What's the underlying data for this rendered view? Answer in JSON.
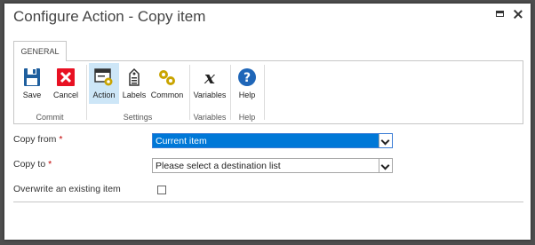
{
  "dialog": {
    "title": "Configure Action - Copy item"
  },
  "ribbon": {
    "tab_label": "GENERAL",
    "groups": [
      {
        "label": "Commit",
        "buttons": [
          {
            "label": "Save",
            "icon": "save-icon"
          },
          {
            "label": "Cancel",
            "icon": "cancel-icon"
          }
        ]
      },
      {
        "label": "Settings",
        "buttons": [
          {
            "label": "Action",
            "icon": "action-icon"
          },
          {
            "label": "Labels",
            "icon": "labels-icon"
          },
          {
            "label": "Common",
            "icon": "common-icon"
          }
        ]
      },
      {
        "label": "Variables",
        "buttons": [
          {
            "label": "Variables",
            "icon": "variables-icon"
          }
        ]
      },
      {
        "label": "Help",
        "buttons": [
          {
            "label": "Help",
            "icon": "help-icon"
          }
        ]
      }
    ]
  },
  "form": {
    "copy_from": {
      "label": "Copy from",
      "required_mark": "*",
      "value": "Current item"
    },
    "copy_to": {
      "label": "Copy to",
      "required_mark": "*",
      "value": "Please select a destination list"
    },
    "overwrite": {
      "label": "Overwrite an existing item",
      "checked": false
    }
  },
  "colors": {
    "save_blue": "#1f5f9e",
    "cancel_red": "#e81123",
    "gear_gold": "#c9a400",
    "help_blue": "#1f66b8",
    "selected_bg": "#cde6f7",
    "select_highlight": "#0078d7"
  }
}
